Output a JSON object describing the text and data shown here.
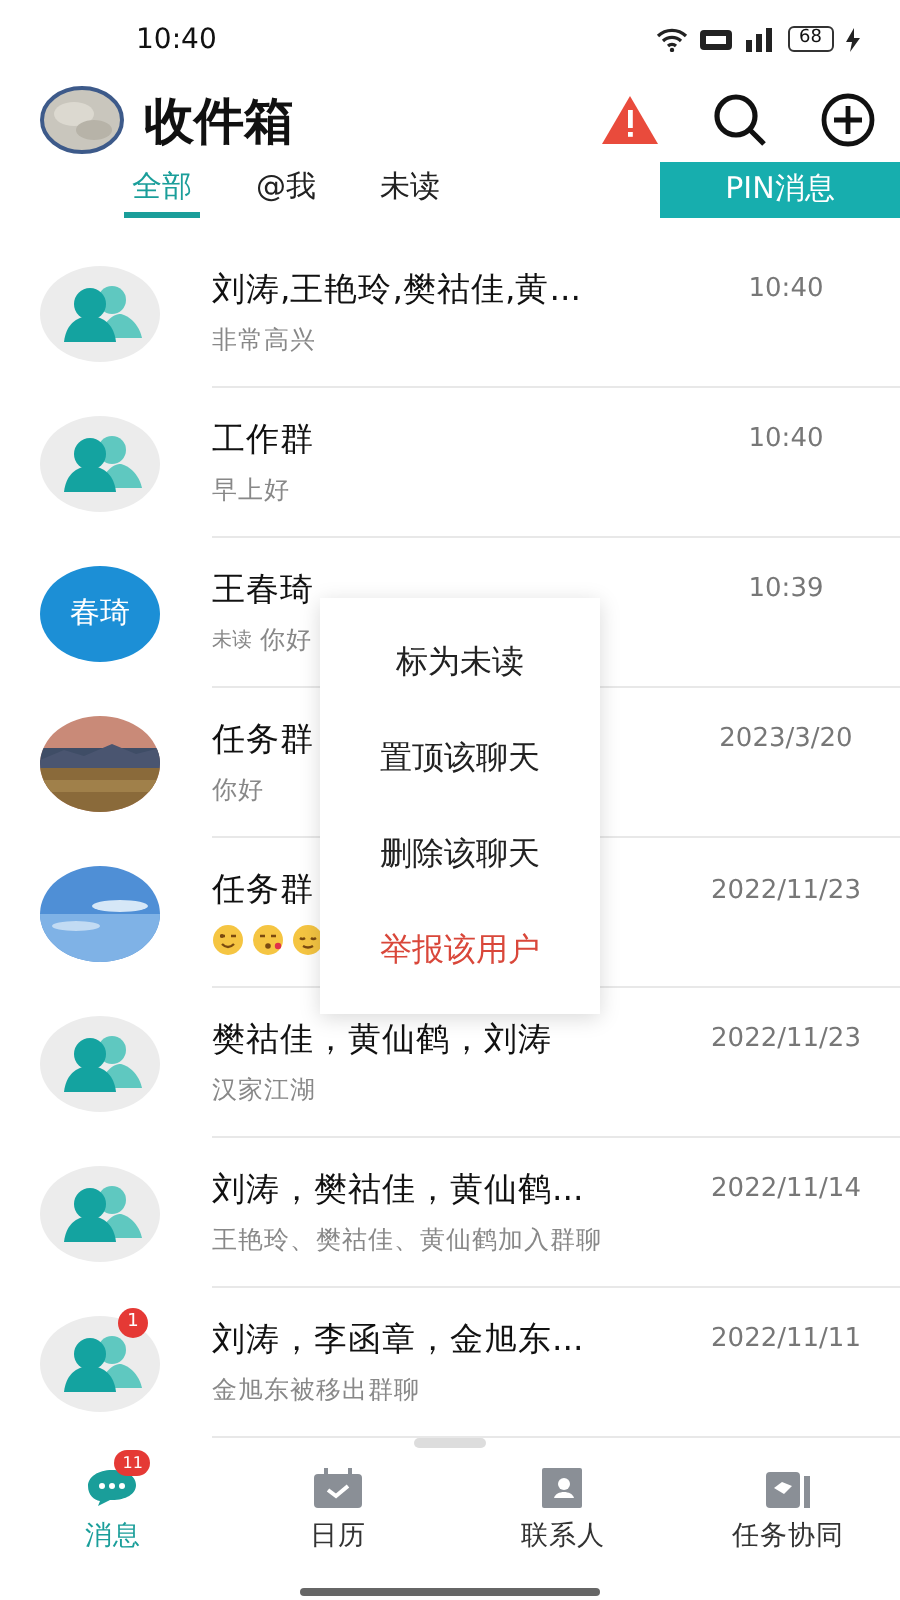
{
  "status_bar": {
    "time": "10:40",
    "battery": "68"
  },
  "header": {
    "title": "收件箱"
  },
  "tabs": [
    {
      "label": "全部",
      "selected": true
    },
    {
      "label": "@我",
      "selected": false
    },
    {
      "label": "未读",
      "selected": false
    }
  ],
  "pin_button": "PIN消息",
  "chats": [
    {
      "avatar": {
        "kind": "group"
      },
      "name": "刘涛,王艳玲,樊祜佳,黄...",
      "preview": "非常高兴",
      "time": "10:40"
    },
    {
      "avatar": {
        "kind": "group"
      },
      "name": "工作群",
      "preview": "早上好",
      "time": "10:40"
    },
    {
      "avatar": {
        "kind": "initials",
        "text": "春琦"
      },
      "name": "王春琦",
      "tag": "未读",
      "preview": "你好",
      "time": "10:39"
    },
    {
      "avatar": {
        "kind": "picture"
      },
      "name": "任务群",
      "preview": "你好",
      "time": "2023/3/20"
    },
    {
      "avatar": {
        "kind": "picture"
      },
      "name": "任务群",
      "emojis": [
        {
          "kind": "wink"
        },
        {
          "kind": "kiss"
        },
        {
          "kind": "relieved"
        }
      ],
      "time": "2022/11/23"
    },
    {
      "avatar": {
        "kind": "group"
      },
      "name": "樊祜佳，黄仙鹤，刘涛",
      "preview": "汉家江湖",
      "time": "2022/11/23"
    },
    {
      "avatar": {
        "kind": "group"
      },
      "name": "刘涛，樊祜佳，黄仙鹤...",
      "preview": "王艳玲、樊祜佳、黄仙鹤加入群聊",
      "time": "2022/11/14"
    },
    {
      "avatar": {
        "kind": "group",
        "badge": "1"
      },
      "name": "刘涛，李函章，金旭东...",
      "preview": "金旭东被移出群聊",
      "time": "2022/11/11"
    }
  ],
  "context_menu": [
    {
      "label": "标为未读",
      "danger": false
    },
    {
      "label": "置顶该聊天",
      "danger": false
    },
    {
      "label": "删除该聊天",
      "danger": false
    },
    {
      "label": "举报该用户",
      "danger": true
    }
  ],
  "bottom_nav": [
    {
      "label": "消息",
      "kind": "chat",
      "selected": true,
      "badge": "11"
    },
    {
      "label": "日历",
      "kind": "calendar",
      "selected": false
    },
    {
      "label": "联系人",
      "kind": "contacts",
      "selected": false
    },
    {
      "label": "任务协同",
      "kind": "tasks",
      "selected": false
    }
  ]
}
